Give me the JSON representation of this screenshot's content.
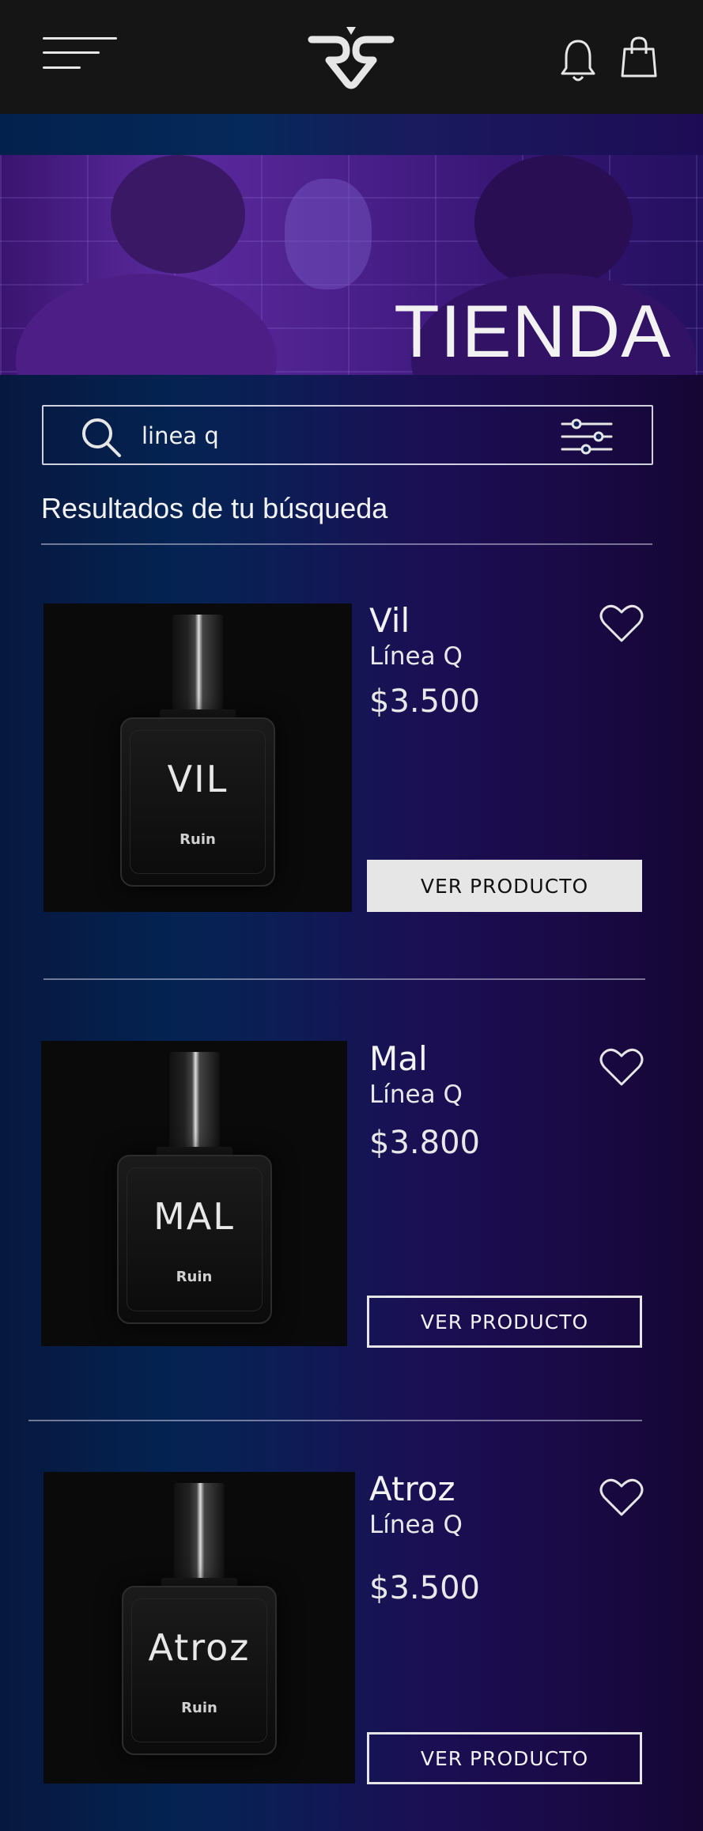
{
  "header": {
    "menu_icon": "hamburger-menu-icon",
    "logo_icon": "ruin-logo-icon",
    "notifications_icon": "bell-icon",
    "cart_icon": "shopping-bag-icon"
  },
  "hero": {
    "title": "TIENDA"
  },
  "search": {
    "value": "linea q",
    "icon": "search-icon",
    "filter_icon": "filter-sliders-icon"
  },
  "results": {
    "title": "Resultados de tu búsqueda"
  },
  "products": [
    {
      "name": "Vil",
      "line": "Línea Q",
      "price": "$3.500",
      "button_label": "VER PRODUCTO",
      "bottle_label": "VIL",
      "bottle_brand": "Ruin"
    },
    {
      "name": "Mal",
      "line": "Línea Q",
      "price": "$3.800",
      "button_label": "VER PRODUCTO",
      "bottle_label": "MAL",
      "bottle_brand": "Ruin"
    },
    {
      "name": "Atroz",
      "line": "Línea Q",
      "price": "$3.500",
      "button_label": "VER PRODUCTO",
      "bottle_label": "Atroz",
      "bottle_brand": "Ruin"
    }
  ],
  "colors": {
    "header_bg": "#151515",
    "hero_purple": "#5b2a9e",
    "button_light": "#e6e6e6"
  }
}
